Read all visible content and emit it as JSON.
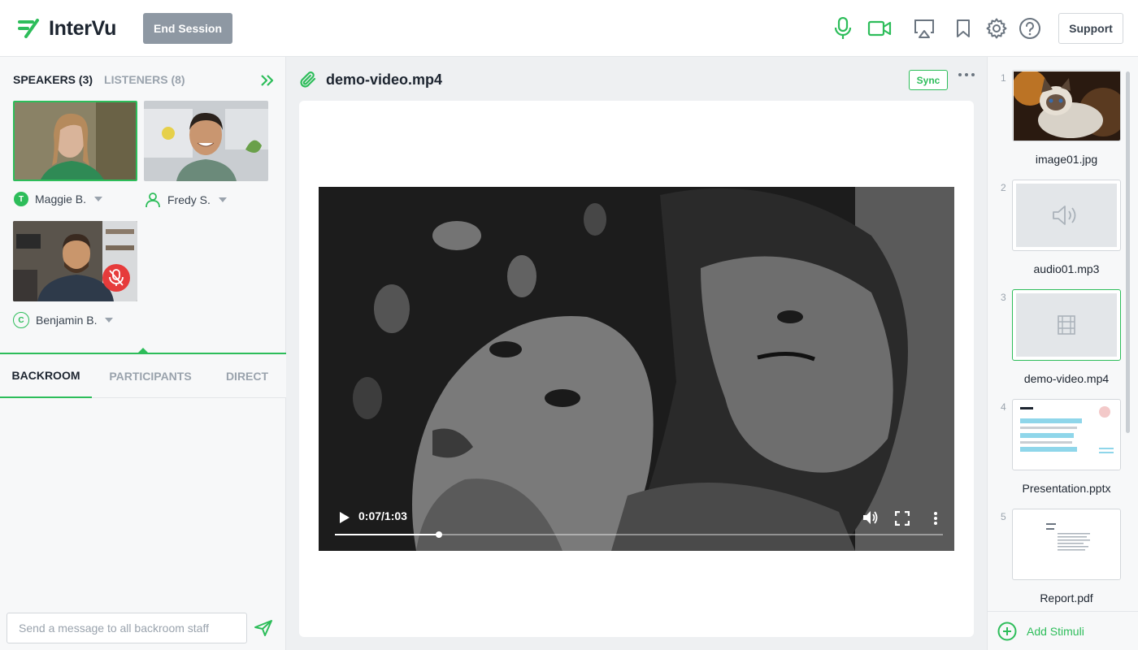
{
  "header": {
    "app_name": "InterVu",
    "end_session_label": "End Session",
    "support_label": "Support",
    "icons": [
      "microphone-icon",
      "video-camera-icon",
      "screen-share-icon",
      "bookmark-icon",
      "gear-icon",
      "help-icon"
    ],
    "accent_color": "#2dbd5a"
  },
  "left": {
    "tab_speakers": "SPEAKERS (3)",
    "tab_listeners": "LISTENERS (8)",
    "speakers": [
      {
        "name": "Maggie B.",
        "badge": "T",
        "active": true
      },
      {
        "name": "Fredy S.",
        "badge": "",
        "active": false
      },
      {
        "name": "Benjamin B.",
        "badge": "C",
        "active": false,
        "muted": true
      }
    ],
    "chat_tabs": [
      "BACKROOM",
      "PARTICIPANTS",
      "DIRECT"
    ],
    "active_chat_tab": "BACKROOM",
    "message_placeholder": "Send a message to all backroom staff"
  },
  "center": {
    "file_name": "demo-video.mp4",
    "sync_label": "Sync",
    "video_time": "0:07/1:03",
    "progress": 0.171
  },
  "right": {
    "stimuli": [
      {
        "num": "1",
        "label": "image01.jpg",
        "kind": "image"
      },
      {
        "num": "2",
        "label": "audio01.mp3",
        "kind": "audio"
      },
      {
        "num": "3",
        "label": "demo-video.mp4",
        "kind": "video",
        "selected": true
      },
      {
        "num": "4",
        "label": "Presentation.pptx",
        "kind": "presentation"
      },
      {
        "num": "5",
        "label": "Report.pdf",
        "kind": "pdf"
      }
    ],
    "add_label": "Add Stimuli"
  }
}
